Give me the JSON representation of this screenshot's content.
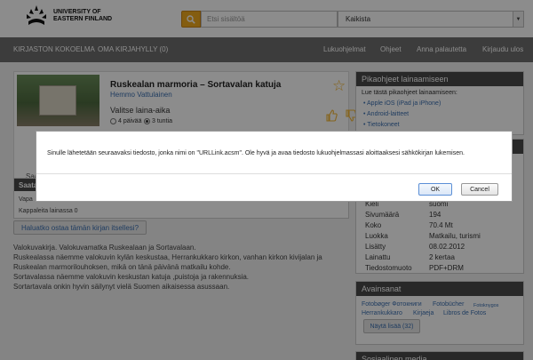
{
  "header": {
    "logo_line1": "UNIVERSITY OF",
    "logo_line2": "EASTERN FINLAND",
    "search_placeholder": "Etsi sisältöä",
    "scope_value": "Kaikista",
    "accent_color": "#f1a91e"
  },
  "nav": {
    "left_items": [
      "KIRJASTON KOKOELMA",
      "OMA KIRJAHYLLY (0)"
    ],
    "right_items": [
      "Lukuohjelmat",
      "Ohjeet",
      "Anna palautetta",
      "Kirjaudu ulos"
    ]
  },
  "book": {
    "title": "Ruskealan marmoria – Sortavalan katuja",
    "author": "Hemmo Vattulainen",
    "loan_period_label": "Valitse laina-aika",
    "loan_options": [
      "4 päivää",
      "3 tuntia"
    ],
    "loan_selected": "3 tuntia",
    "saat_text": "Saat l"
  },
  "availability": {
    "header": "Saata",
    "row1": "Vapa",
    "row2": "Kappaleita lainassa 0"
  },
  "buy_button": "Haluatko ostaa tämän kirjan itsellesi?",
  "description": [
    "Valokuvakirja. Valokuvamatka Ruskealaan ja Sortavalaan.",
    "Ruskealassa näemme valokuvin kylän keskustaa, Herrankukkaro kirkon, vanhan kirkon kivijalan ja",
    "Ruskealan marmorilouhoksen, mikä on tänä päivänä matkailu kohde.",
    "Sortavalassa näemme valokuvin keskustan katuja ,puistoja ja rakennuksia.",
    "Sortartavala onkin hyvin säilynyt vielä Suomen aikaisessa asussaan."
  ],
  "guide": {
    "title": "Pikaohjeet lainaamiseen",
    "intro": "Lue tästä pikaohjeet lainaamiseen:",
    "links": [
      "Apple iOS (iPad ja iPhone)",
      "Android-laitteet",
      "Tietokoneet"
    ]
  },
  "metadata": [
    {
      "key": "Kieli",
      "value": "suomi"
    },
    {
      "key": "Sivumäärä",
      "value": "194"
    },
    {
      "key": "Koko",
      "value": "70.4 Mt"
    },
    {
      "key": "Luokka",
      "value": "Matkailu, turismi"
    },
    {
      "key": "Lisätty",
      "value": "08.02.2012"
    },
    {
      "key": "Lainattu",
      "value": "2 kertaa"
    },
    {
      "key": "Tiedostomuoto",
      "value": "PDF+DRM"
    }
  ],
  "keywords": {
    "title": "Avainsanat",
    "items": [
      "Fotobøger Фотокниги",
      "Fotobücher",
      "Fotoknygos",
      "Herrankukkaro",
      "Kirjaeja",
      "Libros de Fotos"
    ],
    "show_more": "Näytä lisää (32)"
  },
  "bottom_box": {
    "title": "Sosiaalinen media"
  },
  "dialog": {
    "message": "Sinulle lähetetään seuraavaksi tiedosto, jonka nimi on \"URLLink.acsm\". Ole hyvä ja avaa tiedosto lukuohjelmassasi aloittaaksesi sähkökirjan lukemisen.",
    "ok_label": "OK",
    "cancel_label": "Cancel"
  }
}
